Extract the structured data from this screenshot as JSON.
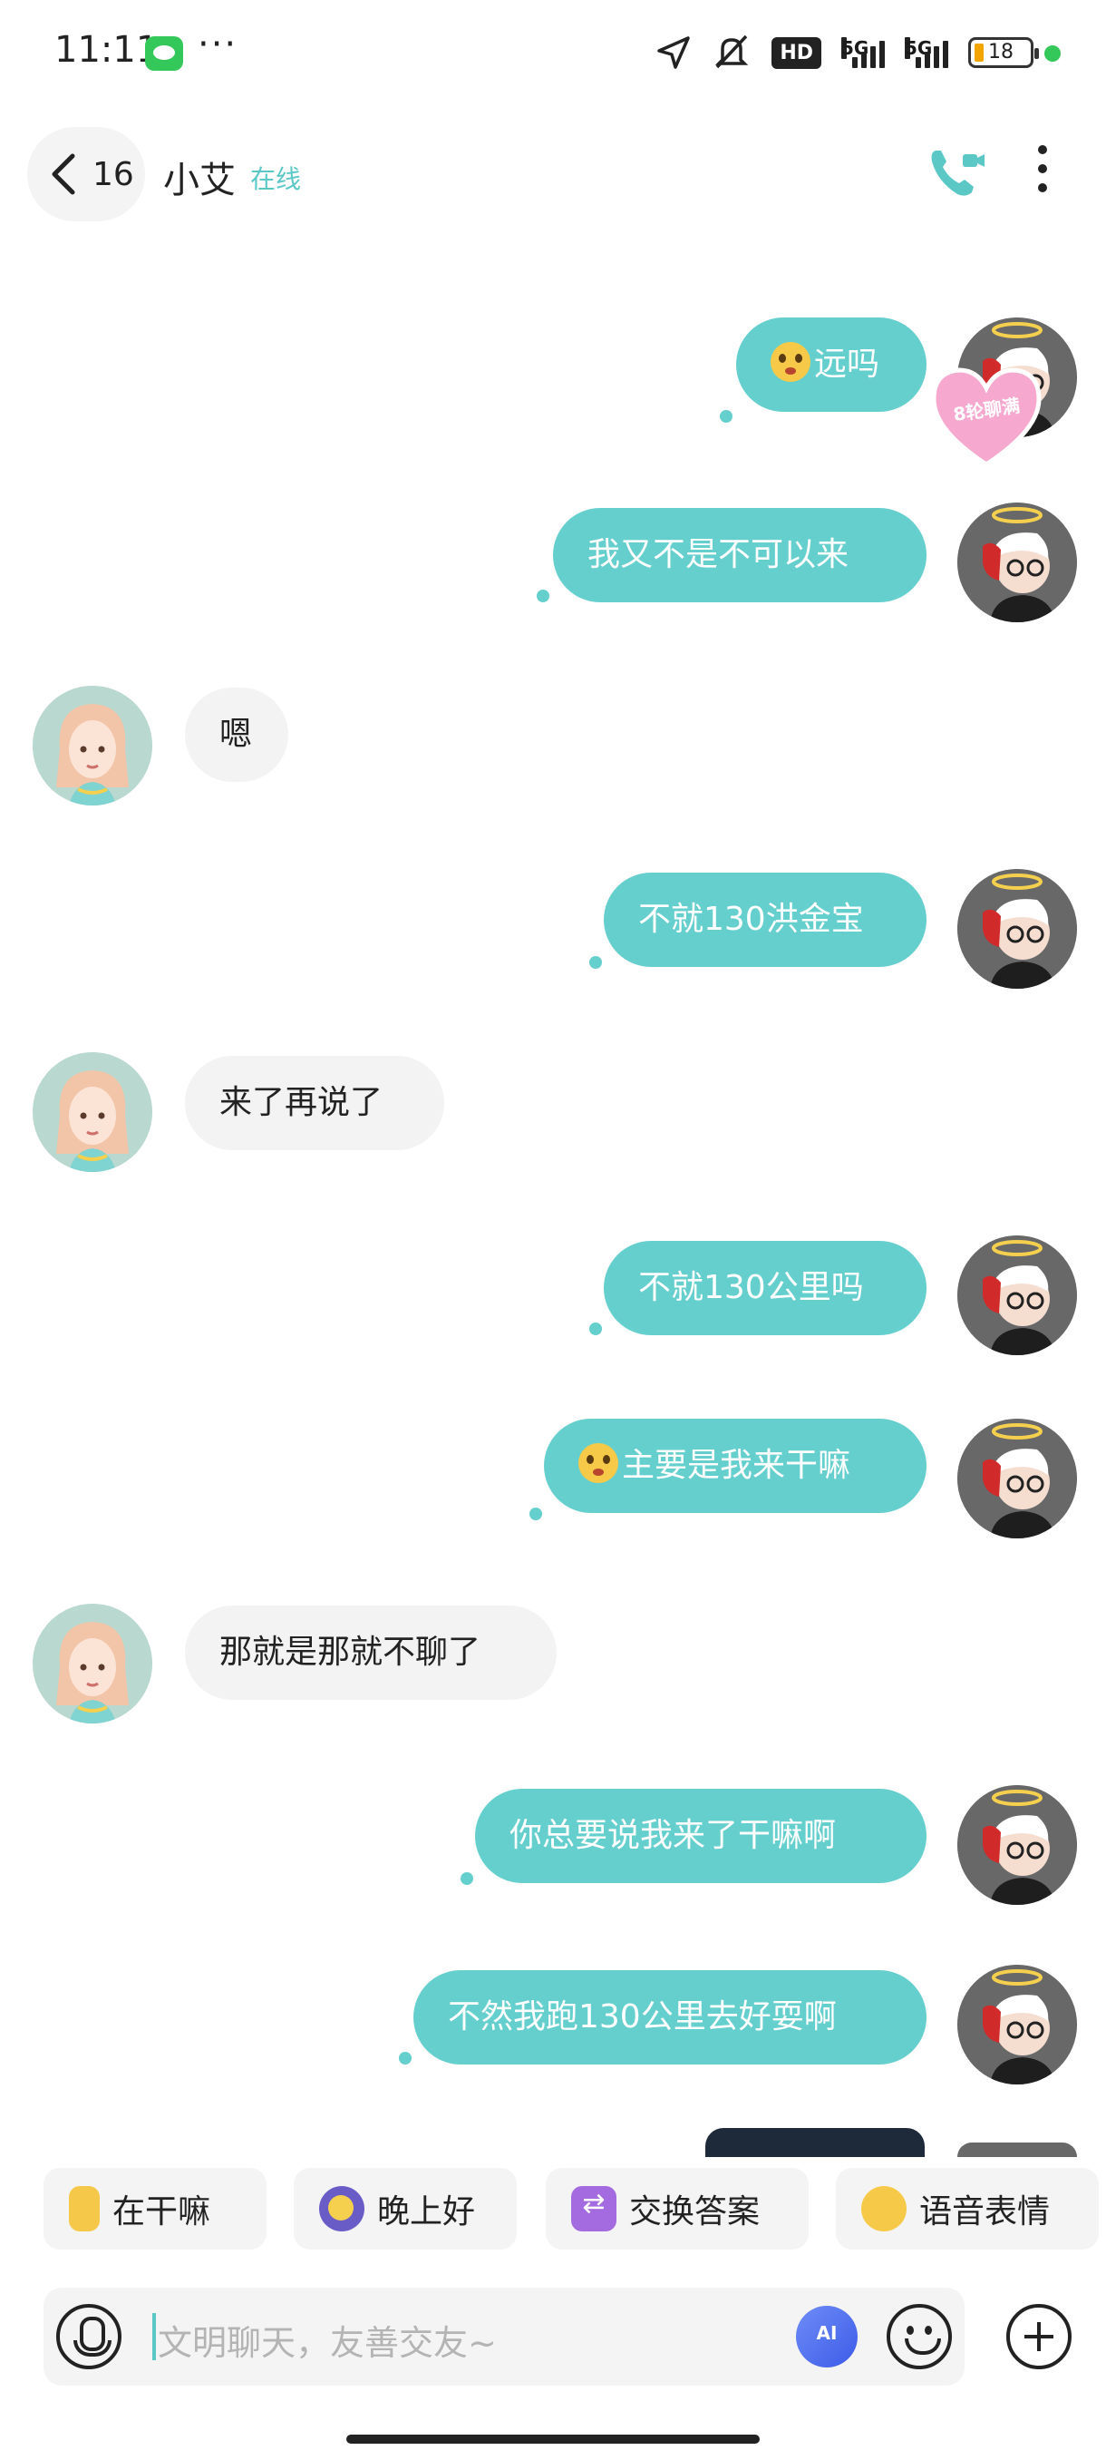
{
  "status_bar": {
    "time": "11:11",
    "more": "···",
    "hd": "HD",
    "net1": "5G",
    "net2": "5G",
    "battery": "18"
  },
  "header": {
    "back_count": "16",
    "contact_name": "小艾",
    "online_status": "在线"
  },
  "heart_badge": "8轮聊满",
  "messages": [
    {
      "side": "me",
      "text": "远吗",
      "emoji": true
    },
    {
      "side": "me",
      "text": "我又不是不可以来",
      "emoji": false
    },
    {
      "side": "her",
      "text": "嗯",
      "emoji": false
    },
    {
      "side": "me",
      "text": "不就130洪金宝",
      "emoji": false
    },
    {
      "side": "her",
      "text": "来了再说了",
      "emoji": false
    },
    {
      "side": "me",
      "text": "不就130公里吗",
      "emoji": false
    },
    {
      "side": "me",
      "text": "主要是我来干嘛",
      "emoji": true
    },
    {
      "side": "her",
      "text": "那就是那就不聊了",
      "emoji": false
    },
    {
      "side": "me",
      "text": "你总要说我来了干嘛啊",
      "emoji": false
    },
    {
      "side": "me",
      "text": "不然我跑130公里去好耍啊",
      "emoji": false
    }
  ],
  "quick_replies": [
    {
      "icon": "busy-icon",
      "label": "在干嘛"
    },
    {
      "icon": "moon-icon",
      "label": "晚上好"
    },
    {
      "icon": "swap-icon",
      "label": "交换答案"
    },
    {
      "icon": "voice-emoji-icon",
      "label": "语音表情"
    }
  ],
  "input": {
    "placeholder": "文明聊天，友善交友~"
  },
  "colors": {
    "my_bubble": "#65cfcd",
    "her_bubble": "#f3f3f3",
    "accent": "#5cc8c6"
  }
}
